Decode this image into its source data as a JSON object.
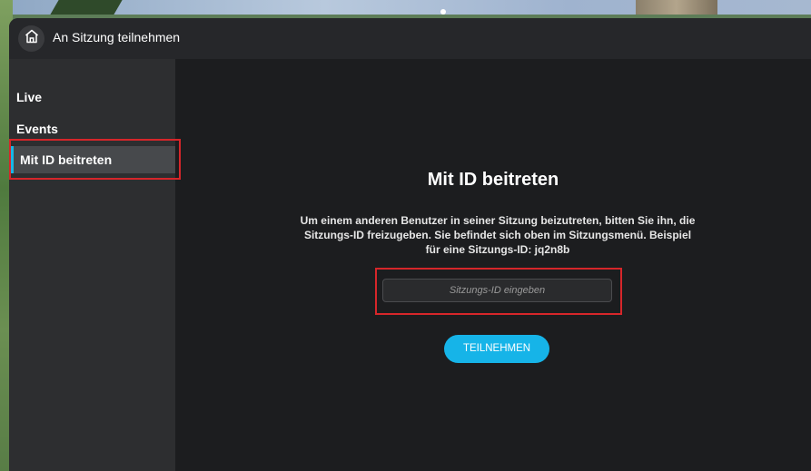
{
  "window": {
    "title": "An Sitzung teilnehmen",
    "home_icon": "home-icon"
  },
  "sidebar": {
    "items": [
      {
        "label": "Live",
        "active": false
      },
      {
        "label": "Events",
        "active": false
      },
      {
        "label": "Mit ID beitreten",
        "active": true
      }
    ]
  },
  "main": {
    "heading": "Mit ID beitreten",
    "description": "Um einem anderen Benutzer in seiner Sitzung beizutreten, bitten Sie ihn, die Sitzungs-ID freizugeben. Sie befindet sich oben im Sitzungsmenü. Beispiel für eine Sitzungs-ID: jq2n8b",
    "session_input": {
      "placeholder": "Sitzungs-ID eingeben",
      "value": ""
    },
    "join_button": "TEILNEHMEN"
  },
  "colors": {
    "accent": "#17b6e6",
    "annotation_red": "#d6262a"
  }
}
